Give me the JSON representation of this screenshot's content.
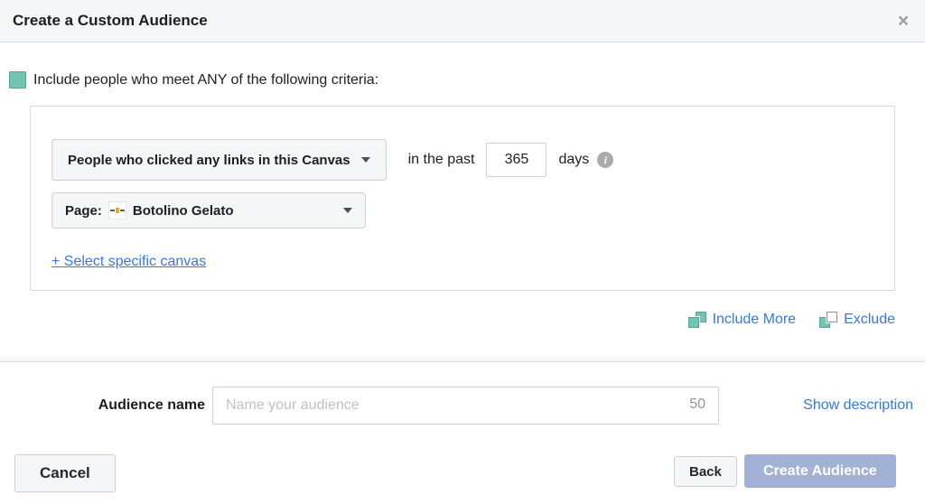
{
  "modal": {
    "title": "Create a Custom Audience",
    "close_icon": "×"
  },
  "criteria": {
    "include_label": "Include people who meet ANY of the following criteria:",
    "behavior_dropdown_value": "People who clicked any links in this Canvas",
    "in_the_past_label": "in the past",
    "days_value": "365",
    "days_label": "days",
    "info_icon_glyph": "i",
    "page_prefix": "Page:",
    "page_name": "Botolino Gelato",
    "select_canvas_link": "+ Select specific canvas",
    "include_more_label": "Include More",
    "exclude_label": "Exclude"
  },
  "audience": {
    "name_label": "Audience name",
    "name_placeholder": "Name your audience",
    "char_count": "50",
    "show_description_link": "Show description"
  },
  "footer": {
    "cancel_label": "Cancel",
    "back_label": "Back",
    "create_label": "Create Audience"
  },
  "colors": {
    "teal": "#72c5b1",
    "link_blue": "#3578e5",
    "disabled_primary_button": "#a1b2d6",
    "header_bg": "#f5f6f7"
  }
}
